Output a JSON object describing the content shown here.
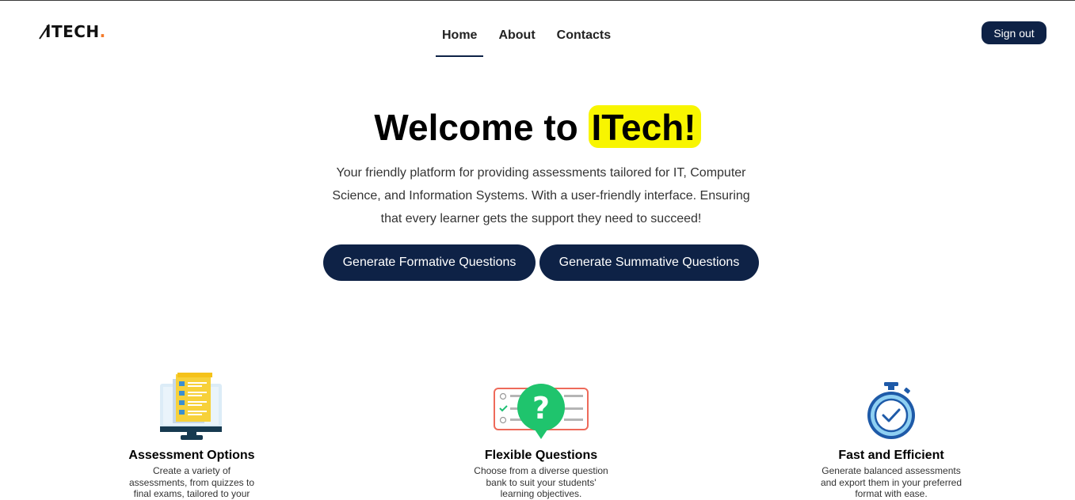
{
  "brand": {
    "logo_text": "ITECH",
    "logo_dot": ".",
    "accent": "#f47a2a"
  },
  "nav": {
    "items": [
      {
        "label": "Home",
        "active": true
      },
      {
        "label": "About",
        "active": false
      },
      {
        "label": "Contacts",
        "active": false
      }
    ]
  },
  "header": {
    "signout_label": "Sign out"
  },
  "hero": {
    "title_prefix": "Welcome to ",
    "title_highlight": "ITech!",
    "subtitle": "Your friendly platform for providing assessments tailored for IT, Computer Science, and Information Systems. With a user-friendly interface. Ensuring that every learner gets the support they need to succeed!",
    "cta_formative": "Generate Formative Questions",
    "cta_summative": "Generate Summative Questions"
  },
  "features": [
    {
      "icon": "assessment-monitor-icon",
      "title": "Assessment Options",
      "desc": "Create a variety of assessments, from quizzes to final exams, tailored to your courses."
    },
    {
      "icon": "question-checklist-icon",
      "title": "Flexible Questions",
      "desc": "Choose from a diverse question bank to suit your students' learning objectives."
    },
    {
      "icon": "stopwatch-icon",
      "title": "Fast and Efficient",
      "desc": "Generate balanced assessments and export them in your preferred format with ease."
    }
  ],
  "colors": {
    "primary": "#0e2246",
    "highlight": "#f8f500",
    "accent": "#f47a2a"
  }
}
